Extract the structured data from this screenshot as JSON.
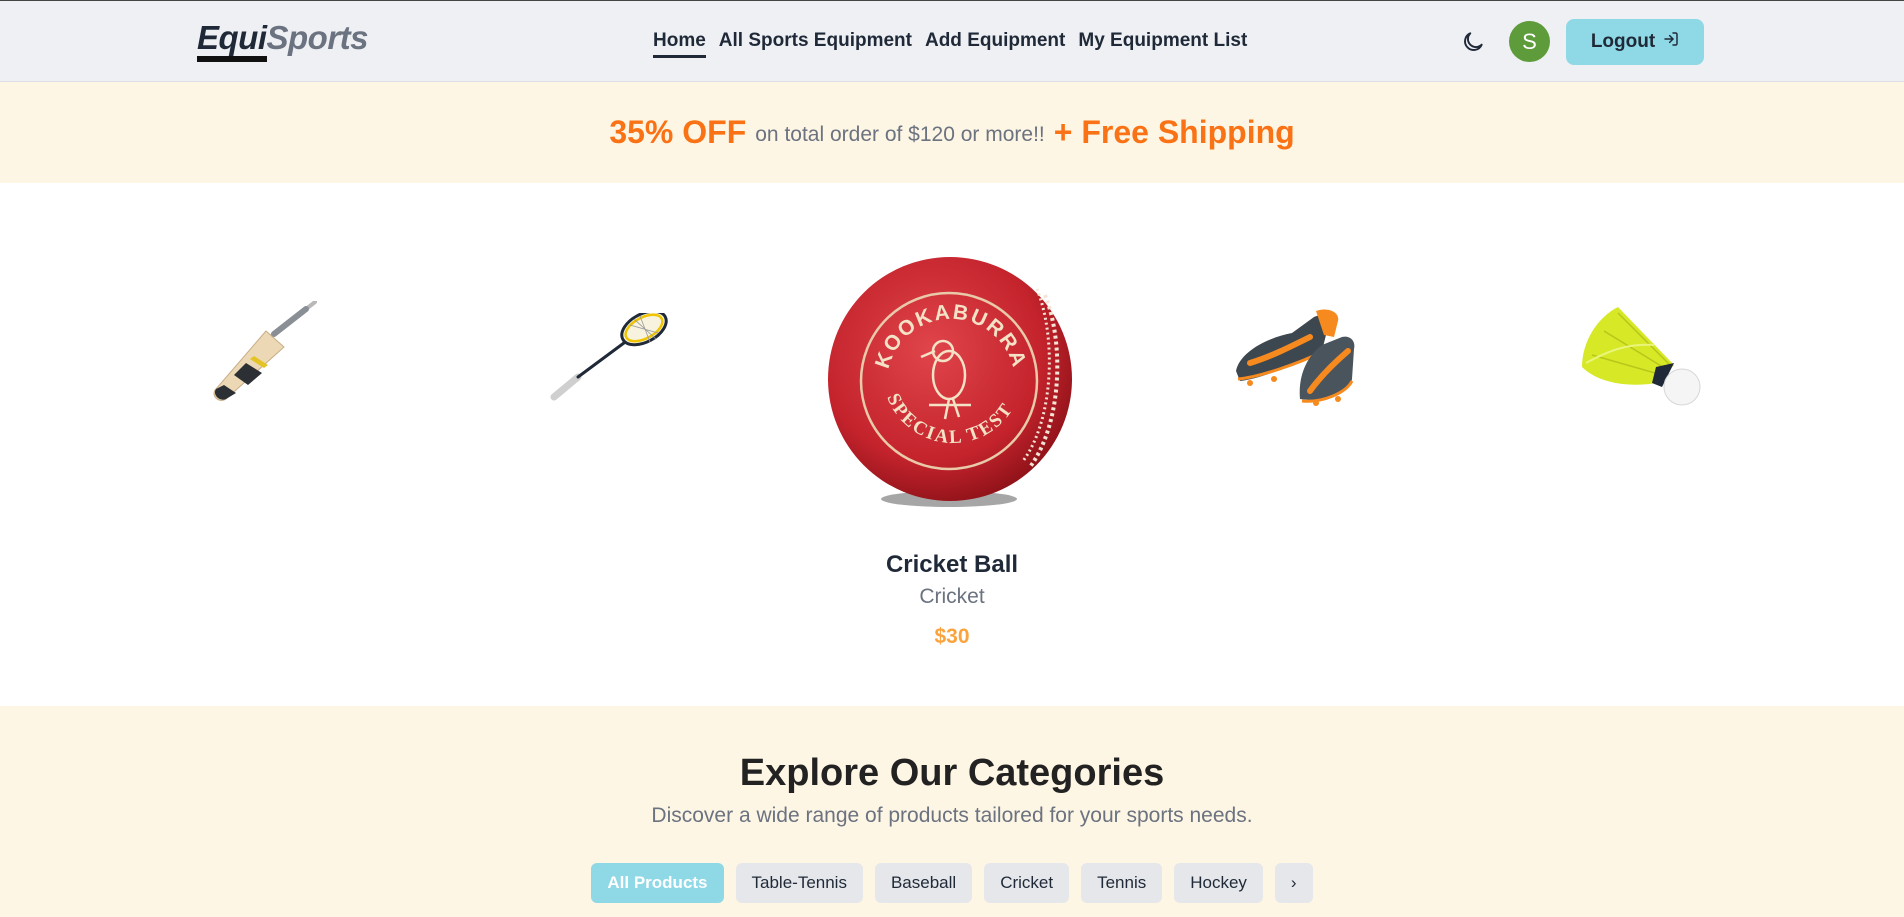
{
  "brand": {
    "part1": "Equi",
    "part2": "Sports"
  },
  "nav": {
    "links": [
      "Home",
      "All Sports Equipment",
      "Add Equipment",
      "My Equipment List"
    ],
    "active": "Home"
  },
  "user": {
    "avatar_letter": "S",
    "logout_label": "Logout"
  },
  "promo": {
    "discount": "35% OFF",
    "condition": "on total order of $120 or more!!",
    "shipping": "+ Free Shipping"
  },
  "carousel": {
    "items": [
      "cricket-bat",
      "badminton-racket",
      "cricket-ball",
      "football-boots",
      "shuttlecock"
    ],
    "active_product": {
      "name": "Cricket Ball",
      "category": "Cricket",
      "price": "$30"
    },
    "ball_text": {
      "top": "KOOKABURRA",
      "bottom": "SPECIAL TEST"
    }
  },
  "categories": {
    "title": "Explore Our Categories",
    "subtitle": "Discover a wide range of products tailored for your sports needs.",
    "pills": [
      "All Products",
      "Table-Tennis",
      "Baseball",
      "Cricket",
      "Tennis",
      "Hockey"
    ],
    "next_label": "›"
  },
  "colors": {
    "accent": "#8fd8e6",
    "promo_orange": "#f97316",
    "price_orange": "#fba33c",
    "avatar_green": "#5e9b3b",
    "cream": "#fef6e4"
  }
}
